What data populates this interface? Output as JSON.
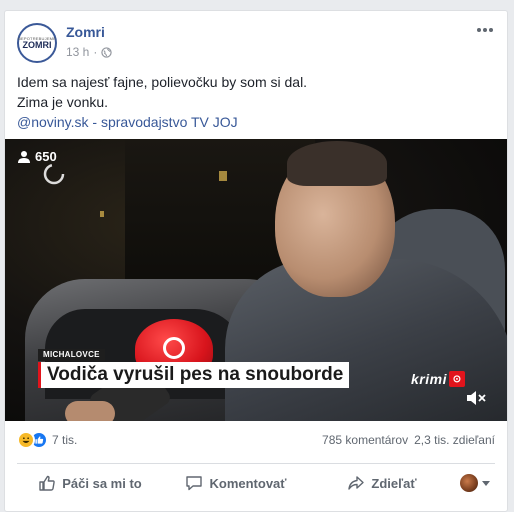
{
  "post": {
    "page_name": "Zomri",
    "avatar_small_text": "NEPOTREBUJEME",
    "avatar_big_text": "ZOMRI",
    "time": "13 h",
    "time_separator": "·",
    "text_line1": "Idem sa najesť fajne, polievočku by som si dal.",
    "text_line2": "Zima je vonku.",
    "text_link": "@noviny.sk",
    "text_line3_rest": " - spravodajstvo TV JOJ"
  },
  "video": {
    "viewer_count": "650",
    "location_tag": "MICHALOVCE",
    "headline": "Vodiča vyrušil pes na snouborde",
    "brand": "krimi",
    "brand_badge": "⊙"
  },
  "engagement": {
    "reaction_count": "7 tis.",
    "comments": "785 komentárov",
    "shares": "2,3 tis. zdieľaní"
  },
  "actions": {
    "like": "Páči sa mi to",
    "comment": "Komentovať",
    "share": "Zdieľať"
  },
  "icons": {
    "globe": "globe-icon",
    "more": "more-icon",
    "like": "thumbs-up-icon",
    "comment": "comment-icon",
    "share": "share-icon"
  },
  "colors": {
    "brand_blue": "#385898",
    "accent_red": "#e1141c",
    "like_blue": "#1877f2",
    "haha_yellow": "#f7b928"
  }
}
